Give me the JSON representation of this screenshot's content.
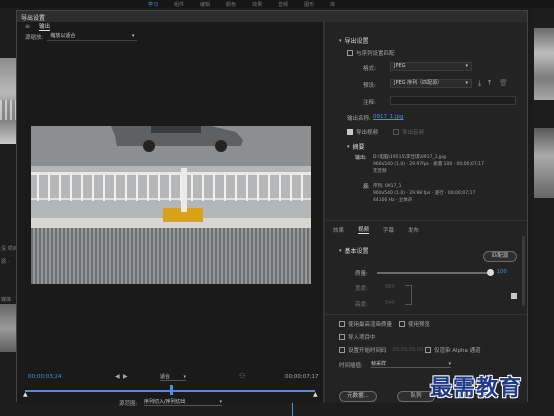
{
  "bg_app": {
    "top_tabs": [
      "学习",
      "组件",
      "编辑",
      "颜色",
      "效果",
      "音频",
      "图形",
      "库"
    ],
    "left_labels": [
      "没 项目:",
      "源 ·",
      "媒体·"
    ],
    "left_side_icon": "≡"
  },
  "dialog": {
    "title": "导出设置",
    "left": {
      "tab": "输出",
      "source_scale_label": "源缩放:",
      "source_scale_value": "缩放以适合",
      "timecode_start": "00;00;03;24",
      "timecode_end": "00;00;07;17",
      "fit_value": "适合",
      "source_range_label": "源范围:",
      "source_range_value": "序列切入/序列切出"
    },
    "right": {
      "export_settings_header": "导出设置",
      "match_sequence_label": "与序列设置匹配",
      "format_label": "格式:",
      "format_value": "JPEG",
      "preset_label": "预设:",
      "preset_value": "JPEG 序列（匹配源）",
      "comment_label": "注释:",
      "output_name_label": "输出名称:",
      "output_name_value": "0917_1.jpg",
      "export_video_label": "导出视频",
      "export_audio_label": "导出音频",
      "summary_header": "摘要",
      "output_label": "输出:",
      "output_lines": [
        "D:\\电脑\\19515\\李佳琪\\0917_1.jpg",
        "960x540 (1.0) · 29.97fps · 质量 100 · 00;00;07;17",
        "无音频"
      ],
      "source_label": "源:",
      "source_lines": [
        "序列, 0917_1",
        "960x540 (1.0) · 29.98 fps · 逐行 · 00;00;07;17",
        "44100 Hz · 立体声"
      ],
      "tabs": [
        "效果",
        "视频",
        "字幕",
        "发布"
      ],
      "basic_settings_header": "基本设置",
      "match_source_button": "匹配源",
      "quality_label": "质量:",
      "quality_value": "100",
      "width_label": "宽度:",
      "width_value": "960",
      "height_label": "高度:",
      "height_value": "540",
      "max_render_label": "使用最高渲染质量",
      "use_preview_label": "使用预览",
      "import_project_label": "导入项目中",
      "set_start_timecode_label": "设置开始时间码",
      "start_timecode_value": "00;00;00;00",
      "alpha_only_label": "仅渲染 Alpha 通道",
      "time_interp_label": "时间插值:",
      "time_interp_value": "帧采样",
      "metadata_button": "元数据...",
      "queue_button": "队列"
    }
  },
  "watermark": "最需教育",
  "colors": {
    "accent": "#4a8fe0",
    "watermark": "#1f3a8a",
    "panel": "#232323",
    "dialog_title_bar": "#2d2d2d"
  }
}
